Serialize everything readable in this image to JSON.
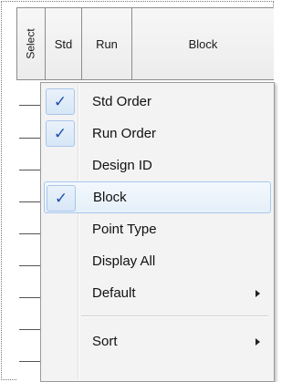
{
  "grid": {
    "headers": {
      "select": "Select",
      "std": "Std",
      "run": "Run",
      "block": "Block"
    }
  },
  "context_menu": {
    "items": [
      {
        "label": "Std Order",
        "checked": true,
        "submenu": false
      },
      {
        "label": "Run Order",
        "checked": true,
        "submenu": false
      },
      {
        "label": "Design ID",
        "checked": false,
        "submenu": false
      },
      {
        "label": "Block",
        "checked": true,
        "submenu": false,
        "highlighted": true
      },
      {
        "label": "Point Type",
        "checked": false,
        "submenu": false
      },
      {
        "label": "Display All",
        "checked": false,
        "submenu": false
      },
      {
        "label": "Default",
        "checked": false,
        "submenu": true
      },
      {
        "label": "Sort",
        "checked": false,
        "submenu": true
      }
    ],
    "check_glyph": "✓",
    "colors": {
      "check": "#1f4fa8",
      "highlight_border": "#a8c8eb",
      "background": "#f3f3f3"
    }
  }
}
